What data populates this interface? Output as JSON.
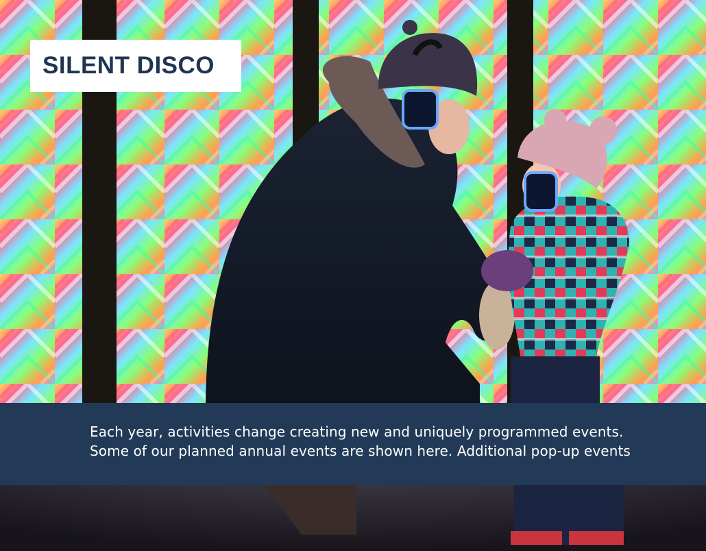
{
  "hero": {
    "title": "SILENT DISCO",
    "image_description_icon": "photo-icon"
  },
  "intro": {
    "line1": "Each year, activities change creating new and uniquely programmed events.",
    "line2": "Some of our planned annual events are shown here. Additional pop-up events"
  },
  "colors": {
    "brand_navy": "#223a57",
    "title_text": "#1f3552",
    "card_bg": "#ffffff"
  }
}
